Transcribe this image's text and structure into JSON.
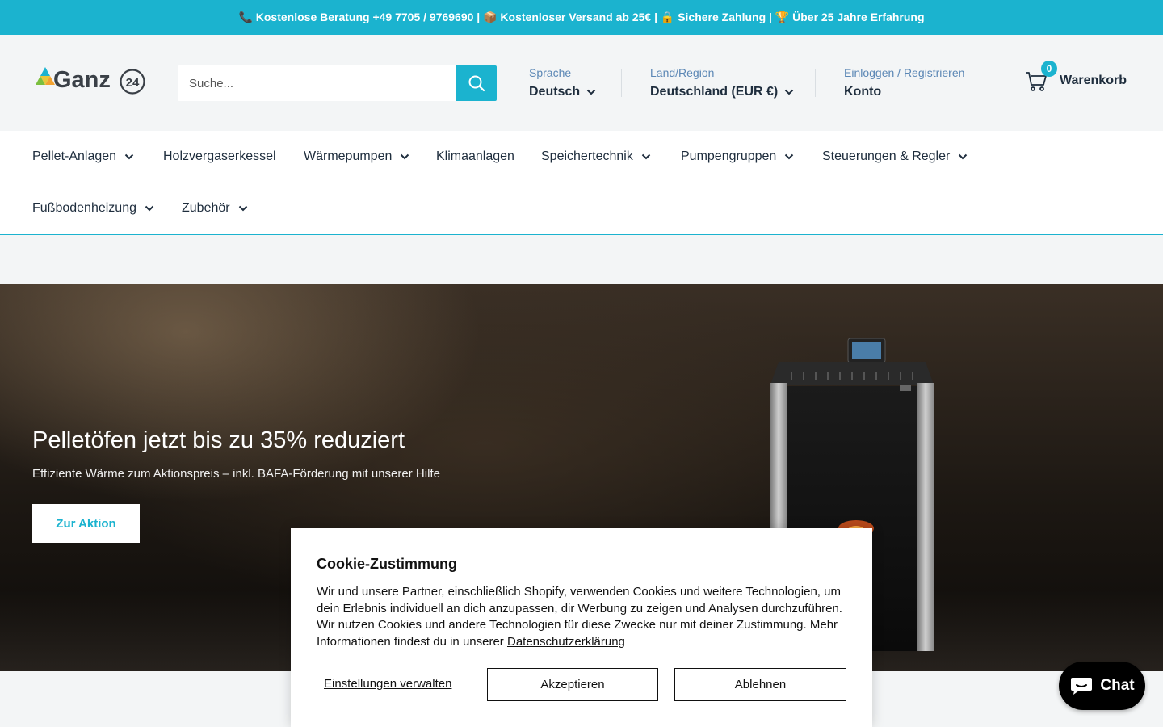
{
  "announcement": "📞 Kostenlose Beratung +49 7705 / 9769690 | 📦 Kostenloser Versand ab 25€ | 🔒 Sichere Zahlung | 🏆 Über 25 Jahre Erfahrung",
  "logo": {
    "text": "Ganz",
    "suffix": "24"
  },
  "search": {
    "placeholder": "Suche..."
  },
  "language": {
    "label": "Sprache",
    "value": "Deutsch"
  },
  "region": {
    "label": "Land/Region",
    "value": "Deutschland (EUR €)"
  },
  "account": {
    "label": "Einloggen / Registrieren",
    "value": "Konto"
  },
  "cart": {
    "count": "0",
    "label": "Warenkorb"
  },
  "nav": [
    {
      "label": "Pellet-Anlagen",
      "dropdown": true
    },
    {
      "label": "Holzvergaserkessel",
      "dropdown": false
    },
    {
      "label": "Wärmepumpen",
      "dropdown": true
    },
    {
      "label": "Klimaanlagen",
      "dropdown": false
    },
    {
      "label": "Speichertechnik",
      "dropdown": true
    },
    {
      "label": "Pumpengruppen",
      "dropdown": true
    },
    {
      "label": "Steuerungen & Regler",
      "dropdown": true
    },
    {
      "label": "Fußbodenheizung",
      "dropdown": true
    },
    {
      "label": "Zubehör",
      "dropdown": true
    }
  ],
  "hero": {
    "title": "Pelletöfen jetzt bis zu 35% reduziert",
    "subtitle": "Effiziente Wärme zum Aktionspreis – inkl. BAFA-Förderung mit unserer Hilfe",
    "button": "Zur Aktion"
  },
  "cookie": {
    "title": "Cookie-Zustimmung",
    "text": "Wir und unsere Partner, einschließlich Shopify, verwenden Cookies und weitere Technologien, um dein Erlebnis individuell an dich anzupassen, dir Werbung zu zeigen und Analysen durchzuführen. Wir nutzen Cookies und andere Technologien für diese Zwecke nur mit deiner Zustimmung. Mehr Informationen findest du in unserer",
    "link": "Datenschutzerklärung",
    "manage": "Einstellungen verwalten",
    "accept": "Akzeptieren",
    "decline": "Ablehnen"
  },
  "chat": {
    "label": "Chat"
  },
  "colors": {
    "accent": "#1bb3cf",
    "text": "#1e2d3d",
    "muted": "#5b87b5"
  }
}
